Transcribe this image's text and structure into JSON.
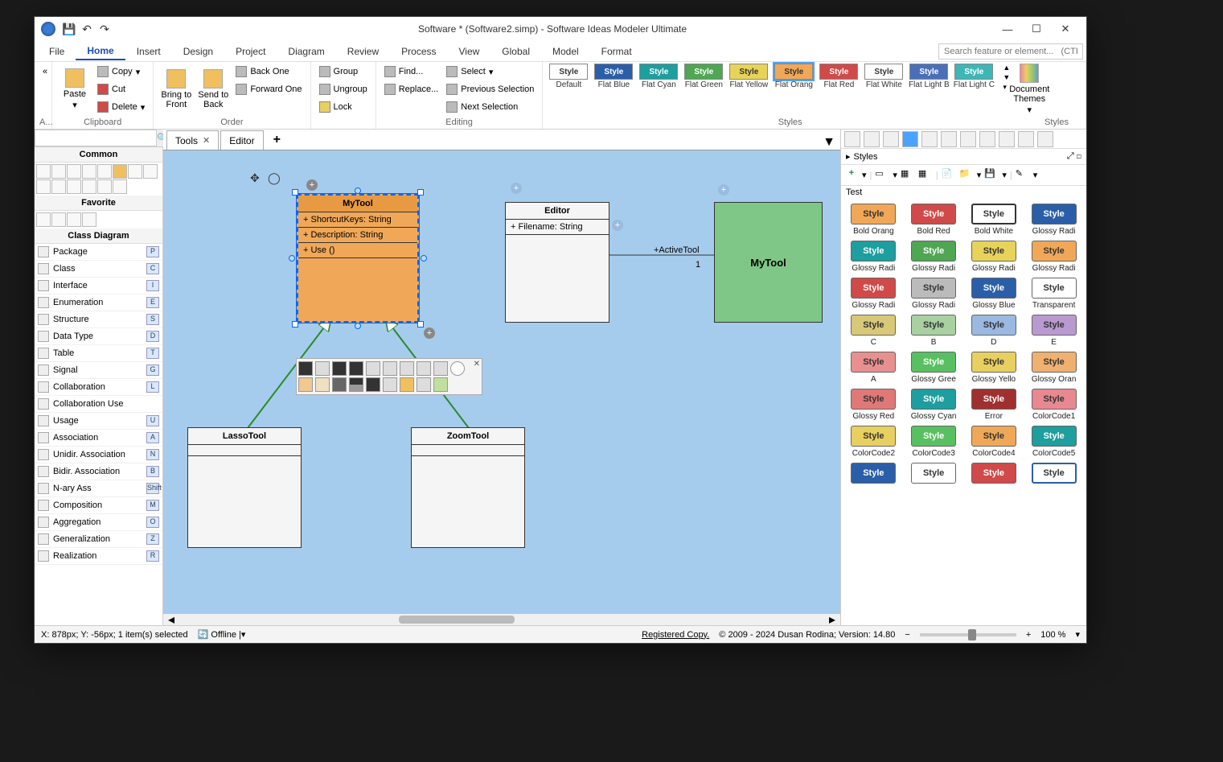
{
  "titlebar": {
    "title": "Software *  (Software2.simp)  - Software Ideas Modeler Ultimate"
  },
  "menu": {
    "items": [
      "File",
      "Home",
      "Insert",
      "Design",
      "Project",
      "Diagram",
      "Review",
      "Process",
      "View",
      "Global",
      "Model",
      "Format"
    ],
    "active": "Home",
    "search_placeholder": "Search feature or element...   (CTRL+Q)"
  },
  "ribbon": {
    "clipboard": {
      "paste": "Paste",
      "copy": "Copy",
      "cut": "Cut",
      "delete": "Delete",
      "label": "Clipboard",
      "aa": "A..."
    },
    "order": {
      "bring_front": "Bring to Front",
      "send_back": "Send to Back",
      "back_one": "Back One",
      "forward_one": "Forward One",
      "label": "Order"
    },
    "group": {
      "group": "Group",
      "ungroup": "Ungroup",
      "lock": "Lock"
    },
    "editing": {
      "find": "Find...",
      "replace": "Replace...",
      "select": "Select",
      "prev": "Previous Selection",
      "next": "Next Selection",
      "label": "Editing"
    },
    "styles": {
      "label": "Styles",
      "items": [
        {
          "name": "Default",
          "bg": "#ffffff",
          "fg": "#333333"
        },
        {
          "name": "Flat Blue",
          "bg": "#2b5ea8",
          "fg": "#ffffff"
        },
        {
          "name": "Flat Cyan",
          "bg": "#1e9e9e",
          "fg": "#ffffff"
        },
        {
          "name": "Flat Green",
          "bg": "#4fa653",
          "fg": "#ffffff"
        },
        {
          "name": "Flat Yellow",
          "bg": "#e8d35a",
          "fg": "#333333"
        },
        {
          "name": "Flat Orang",
          "bg": "#f0a858",
          "fg": "#333333",
          "selected": true
        },
        {
          "name": "Flat Red",
          "bg": "#d04a4a",
          "fg": "#ffffff"
        },
        {
          "name": "Flat White",
          "bg": "#ffffff",
          "fg": "#333333"
        },
        {
          "name": "Flat Light B",
          "bg": "#4a6fb8",
          "fg": "#ffffff"
        },
        {
          "name": "Flat Light C",
          "bg": "#3eb6b6",
          "fg": "#ffffff"
        }
      ],
      "themes": "Document Themes",
      "group2": "Styles"
    }
  },
  "left": {
    "common": "Common",
    "favorite": "Favorite",
    "class_diagram": "Class Diagram",
    "tools": [
      {
        "name": "Package",
        "key": "P"
      },
      {
        "name": "Class",
        "key": "C"
      },
      {
        "name": "Interface",
        "key": "I"
      },
      {
        "name": "Enumeration",
        "key": "E"
      },
      {
        "name": "Structure",
        "key": "S"
      },
      {
        "name": "Data Type",
        "key": "D"
      },
      {
        "name": "Table",
        "key": "T"
      },
      {
        "name": "Signal",
        "key": "G"
      },
      {
        "name": "Collaboration",
        "key": "L"
      },
      {
        "name": "Collaboration Use",
        "key": ""
      },
      {
        "name": "Usage",
        "key": "U"
      },
      {
        "name": "Association",
        "key": "A"
      },
      {
        "name": "Unidir. Association",
        "key": "N"
      },
      {
        "name": "Bidir. Association",
        "key": "B"
      },
      {
        "name": "N-ary Ass",
        "key": "Shift+R"
      },
      {
        "name": "Composition",
        "key": "M"
      },
      {
        "name": "Aggregation",
        "key": "O"
      },
      {
        "name": "Generalization",
        "key": "Z"
      },
      {
        "name": "Realization",
        "key": "R"
      }
    ]
  },
  "tabs": {
    "items": [
      "Tools",
      "Editor"
    ],
    "active": "Tools"
  },
  "canvas": {
    "mytool": {
      "name": "MyTool",
      "attrs": [
        "+ ShortcutKeys: String",
        "+ Description: String"
      ],
      "ops": [
        "+ Use ()"
      ]
    },
    "editor": {
      "name": "Editor",
      "attrs": [
        "+ Filename: String"
      ]
    },
    "lasso": {
      "name": "LassoTool"
    },
    "zoom": {
      "name": "ZoomTool"
    },
    "mytool2": {
      "name": "MyTool"
    },
    "assoc_label": "+ActiveTool",
    "assoc_mult": "1"
  },
  "right": {
    "tab": "Styles",
    "test": "Test",
    "grid": [
      {
        "bg": "#f0a858",
        "fg": "#333",
        "name": "Bold Orang"
      },
      {
        "bg": "#d04a4a",
        "fg": "#fff",
        "name": "Bold Red"
      },
      {
        "bg": "#ffffff",
        "fg": "#333",
        "name": "Bold White",
        "border": "2px solid #333"
      },
      {
        "bg": "#2b5ea8",
        "fg": "#fff",
        "name": "Glossy Radi"
      },
      {
        "bg": "#1e9e9e",
        "fg": "#fff",
        "name": "Glossy Radi"
      },
      {
        "bg": "#4fa653",
        "fg": "#fff",
        "name": "Glossy Radi"
      },
      {
        "bg": "#e8d35a",
        "fg": "#333",
        "name": "Glossy Radi"
      },
      {
        "bg": "#f0a858",
        "fg": "#333",
        "name": "Glossy Radi"
      },
      {
        "bg": "#d04a4a",
        "fg": "#fff",
        "name": "Glossy Radi"
      },
      {
        "bg": "#bbbbbb",
        "fg": "#333",
        "name": "Glossy Radi"
      },
      {
        "bg": "#2b5ea8",
        "fg": "#fff",
        "name": "Glossy Blue"
      },
      {
        "bg": "#ffffff",
        "fg": "#333",
        "name": "Transparent"
      },
      {
        "bg": "#d8c878",
        "fg": "#333",
        "name": "C"
      },
      {
        "bg": "#a8d0a0",
        "fg": "#333",
        "name": "B"
      },
      {
        "bg": "#9ab8e0",
        "fg": "#333",
        "name": "D"
      },
      {
        "bg": "#b89ad0",
        "fg": "#333",
        "name": "E"
      },
      {
        "bg": "#e89090",
        "fg": "#333",
        "name": "A"
      },
      {
        "bg": "#58c060",
        "fg": "#fff",
        "name": "Glossy Gree"
      },
      {
        "bg": "#e8d060",
        "fg": "#333",
        "name": "Glossy Yello"
      },
      {
        "bg": "#f0b070",
        "fg": "#333",
        "name": "Glossy Oran"
      },
      {
        "bg": "#e07878",
        "fg": "#333",
        "name": "Glossy Red"
      },
      {
        "bg": "#1e9e9e",
        "fg": "#fff",
        "name": "Glossy Cyan"
      },
      {
        "bg": "#a03030",
        "fg": "#fff",
        "name": "Error"
      },
      {
        "bg": "#e88890",
        "fg": "#333",
        "name": "ColorCode1"
      },
      {
        "bg": "#e8d060",
        "fg": "#333",
        "name": "ColorCode2"
      },
      {
        "bg": "#58c060",
        "fg": "#fff",
        "name": "ColorCode3"
      },
      {
        "bg": "#f0a858",
        "fg": "#333",
        "name": "ColorCode4"
      },
      {
        "bg": "#1e9e9e",
        "fg": "#fff",
        "name": "ColorCode5"
      },
      {
        "bg": "#2b5ea8",
        "fg": "#fff",
        "name": ""
      },
      {
        "bg": "#ffffff",
        "fg": "#333",
        "name": ""
      },
      {
        "bg": "#d04a4a",
        "fg": "#fff",
        "name": ""
      },
      {
        "bg": "#ffffff",
        "fg": "#333",
        "name": "",
        "border": "2px solid #2b5ea8"
      }
    ]
  },
  "status": {
    "coords": "X: 878px; Y: -56px; 1 item(s) selected",
    "offline": "Offline",
    "registered": "Registered Copy.",
    "copyright": "© 2009 - 2024 Dusan Rodina; Version: 14.80",
    "zoom": "100 %"
  }
}
